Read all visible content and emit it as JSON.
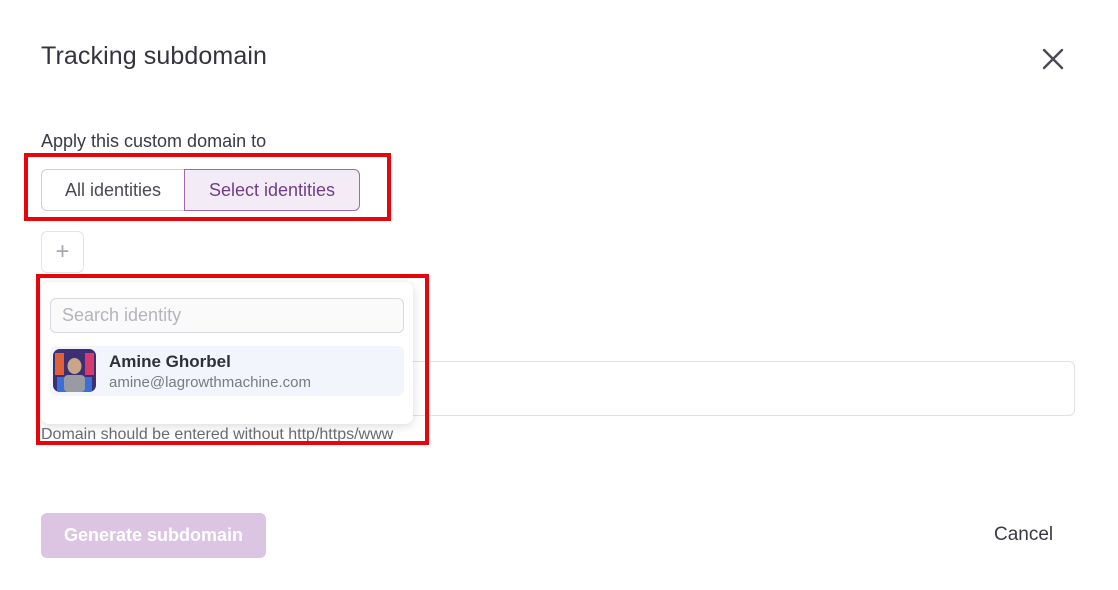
{
  "dialog": {
    "title": "Tracking subdomain",
    "close_icon": "close-icon"
  },
  "apply": {
    "label": "Apply this custom domain to",
    "options": [
      "All identities",
      "Select identities"
    ],
    "selected": "Select identities"
  },
  "add_button": {
    "label": "+",
    "icon": "plus-icon"
  },
  "dropdown": {
    "search_placeholder": "Search identity",
    "identities": [
      {
        "name": "Amine Ghorbel",
        "email": "amine@lagrowthmachine.com",
        "avatar": "avatar-photo"
      }
    ]
  },
  "domain_field": {
    "helper": "Domain should be entered without http/https/www"
  },
  "footer": {
    "generate_label": "Generate subdomain",
    "cancel_label": "Cancel"
  },
  "colors": {
    "accent": "#6e3f86",
    "accent_bg": "#f3ecf7",
    "disabled_button": "#dbc5e2",
    "highlight": "#e6050b"
  }
}
